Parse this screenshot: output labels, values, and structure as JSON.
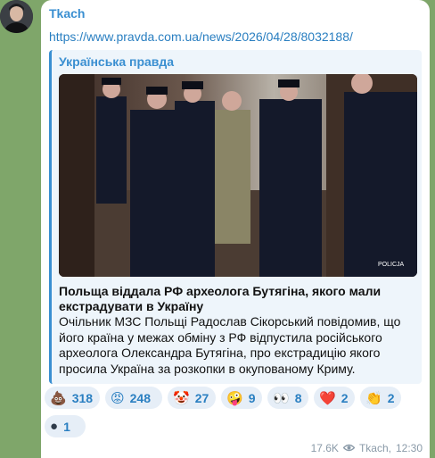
{
  "post": {
    "author": "Tkach",
    "url": "https://www.pravda.com.ua/news/2026/04/28/8032188/",
    "preview": {
      "site_name": "Українська правда",
      "headline": "Польща віддала РФ археолога Бутягіна, якого мали екстрадувати в Україну",
      "description": "Очільник МЗС Польщі Радослав Сікорський повідомив, що його країна у межах обміну з РФ відпустила російського археолога Олександра Бутягіна, про екстрадицію якого просила Україна за розкопки в окупованому Криму.",
      "photo_badge": "POLICJA"
    },
    "reactions": [
      {
        "icon": "poop-emoji",
        "glyph": "💩",
        "count": "318"
      },
      {
        "icon": "angry-face-emoji",
        "glyph": "😡",
        "count": "248"
      },
      {
        "icon": "clown-face-emoji",
        "glyph": "🤡",
        "count": "27"
      },
      {
        "icon": "woozy-face-emoji",
        "glyph": "🤪",
        "count": "9"
      },
      {
        "icon": "eyes-emoji",
        "glyph": "👀",
        "count": "8"
      },
      {
        "icon": "red-heart-emoji",
        "glyph": "❤️",
        "count": "2"
      },
      {
        "icon": "clapping-hands-emoji",
        "glyph": "👏",
        "count": "2"
      },
      {
        "icon": "dark-ball-emoji",
        "glyph": "●",
        "count": "1"
      }
    ],
    "views": "17.6K",
    "signature": "Tkach",
    "time": "12:30"
  }
}
